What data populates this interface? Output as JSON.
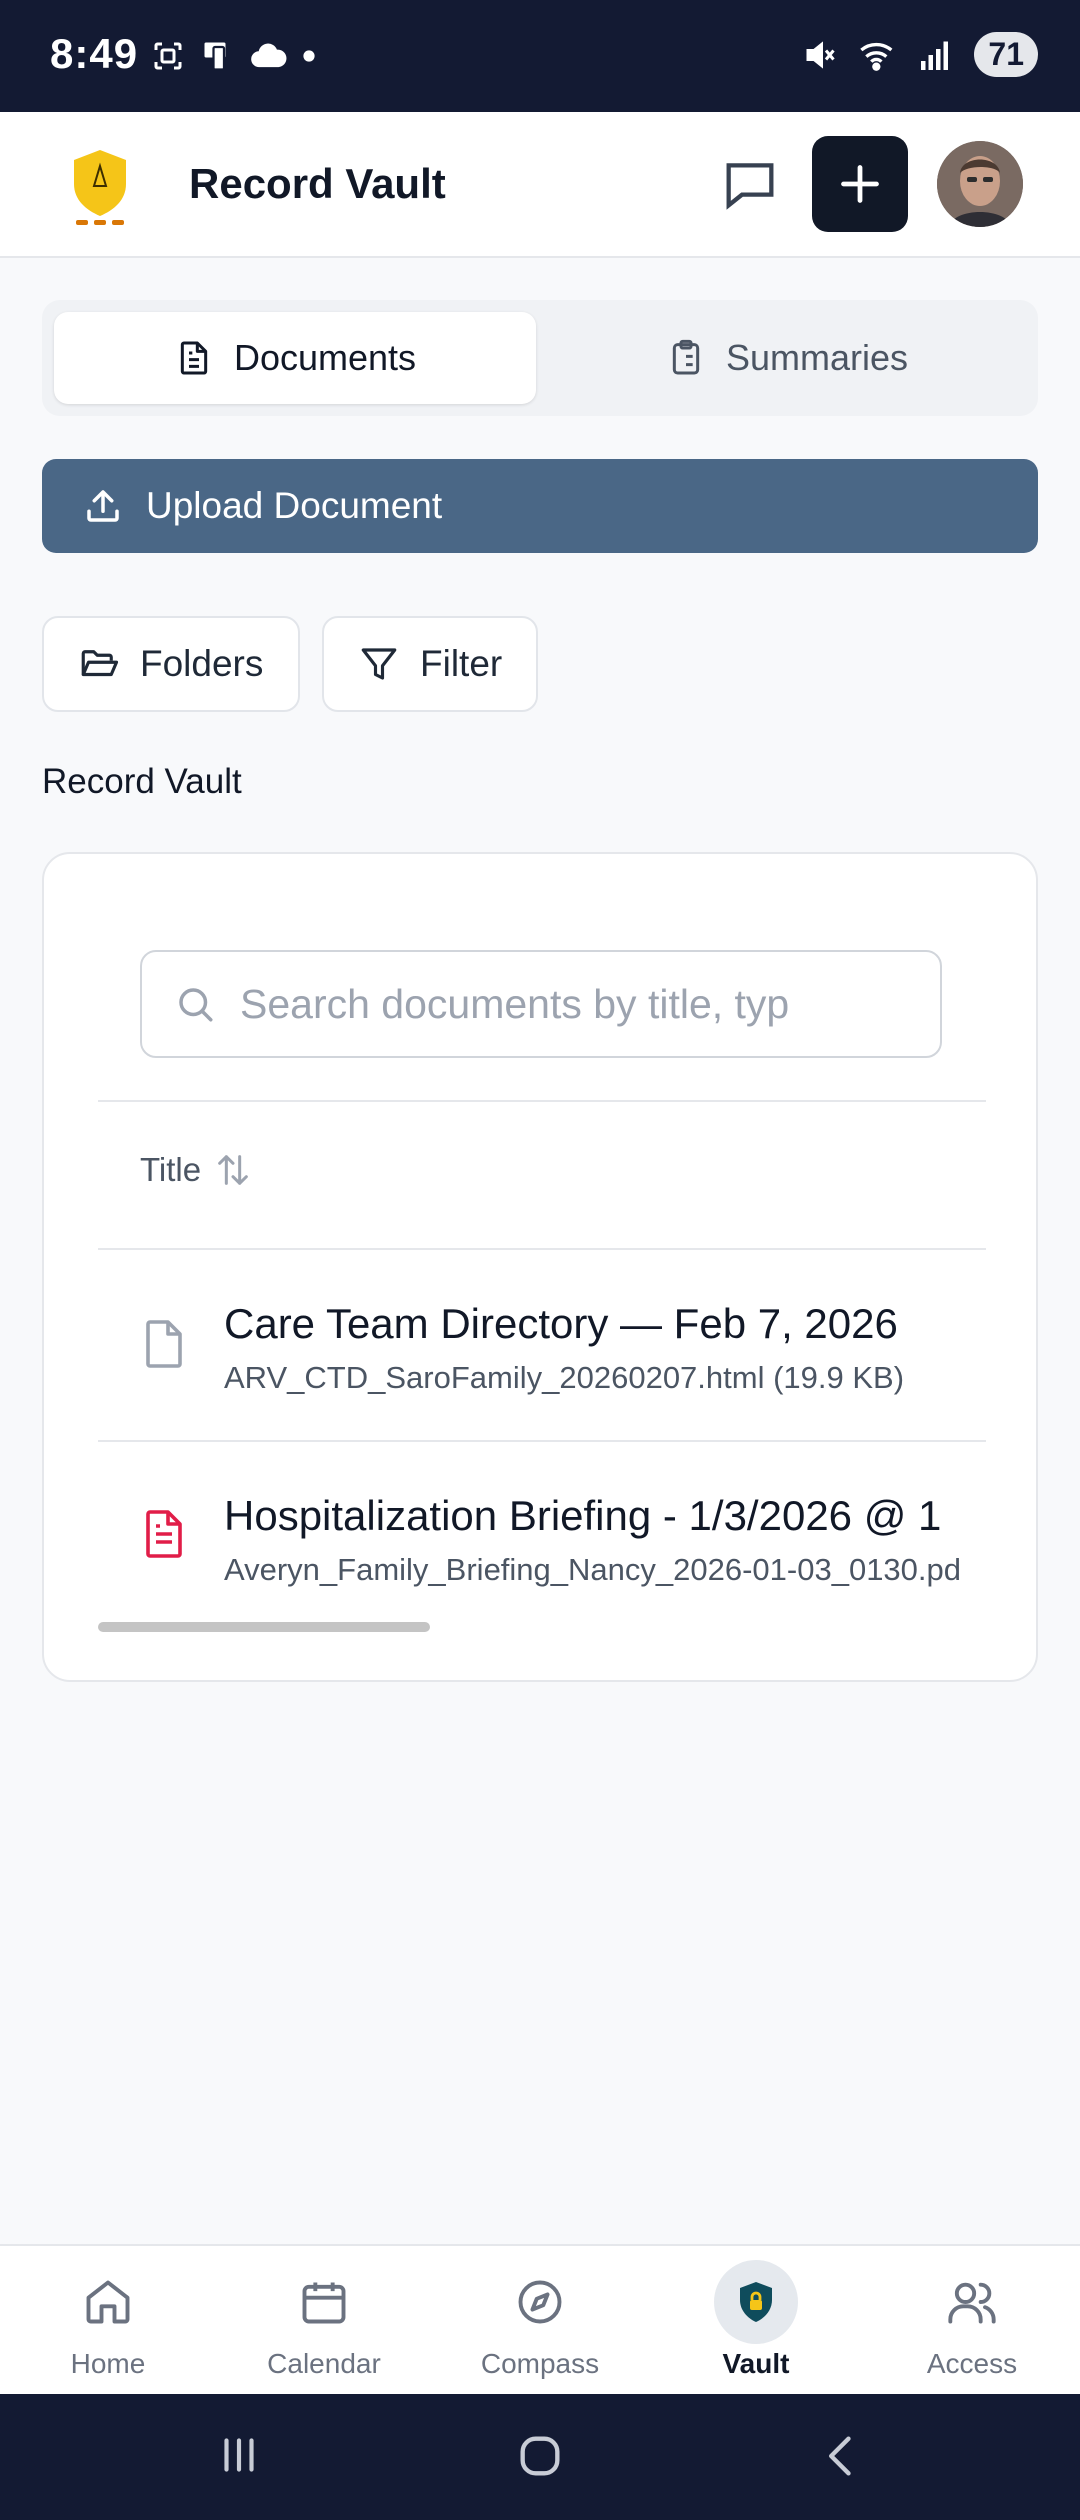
{
  "status_bar": {
    "time": "8:49",
    "battery": "71"
  },
  "header": {
    "title": "Record Vault"
  },
  "tabs": [
    {
      "label": "Documents",
      "active": true
    },
    {
      "label": "Summaries",
      "active": false
    }
  ],
  "upload_button": {
    "label": "Upload Document"
  },
  "chips": {
    "folders": "Folders",
    "filter": "Filter"
  },
  "section_label": "Record Vault",
  "search": {
    "placeholder": "Search documents by title, typ"
  },
  "table": {
    "header": "Title",
    "rows": [
      {
        "title": "Care Team Directory — Feb 7, 2026",
        "subtitle": "ARV_CTD_SaroFamily_20260207.html (19.9 KB)",
        "icon": "file-icon"
      },
      {
        "title": "Hospitalization Briefing - 1/3/2026 @ 1",
        "subtitle": "Averyn_Family_Briefing_Nancy_2026-01-03_0130.pd",
        "icon": "file-text-icon"
      }
    ]
  },
  "bottom_nav": [
    {
      "label": "Home",
      "icon": "home-icon"
    },
    {
      "label": "Calendar",
      "icon": "calendar-icon"
    },
    {
      "label": "Compass",
      "icon": "compass-icon"
    },
    {
      "label": "Vault",
      "icon": "shield-lock-icon",
      "active": true
    },
    {
      "label": "Access",
      "icon": "users-icon"
    }
  ],
  "colors": {
    "primary_dark": "#111827",
    "upload_blue": "#4a6786",
    "pdf_red": "#e11d48",
    "status_bar": "#131a33"
  }
}
